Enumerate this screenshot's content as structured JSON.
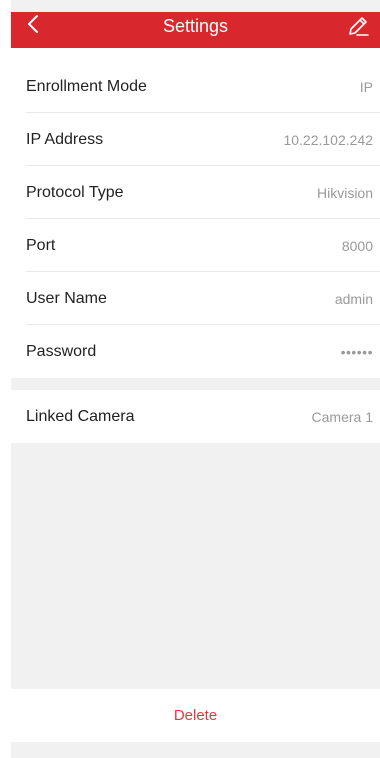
{
  "header": {
    "title": "Settings",
    "back_icon": "chevron-left-icon",
    "edit_icon": "pencil-icon",
    "bar_color": "#d9272e"
  },
  "device": [
    {
      "label": "Enrollment Mode",
      "value": "IP"
    },
    {
      "label": "IP Address",
      "value": "10.22.102.242"
    },
    {
      "label": "Protocol Type",
      "value": "Hikvision"
    },
    {
      "label": "Port",
      "value": "8000"
    },
    {
      "label": "User Name",
      "value": "admin"
    },
    {
      "label": "Password",
      "value": "••••••"
    }
  ],
  "linked": {
    "label": "Linked Camera",
    "value": "Camera 1"
  },
  "actions": {
    "delete_label": "Delete",
    "delete_color": "#e5383b"
  }
}
